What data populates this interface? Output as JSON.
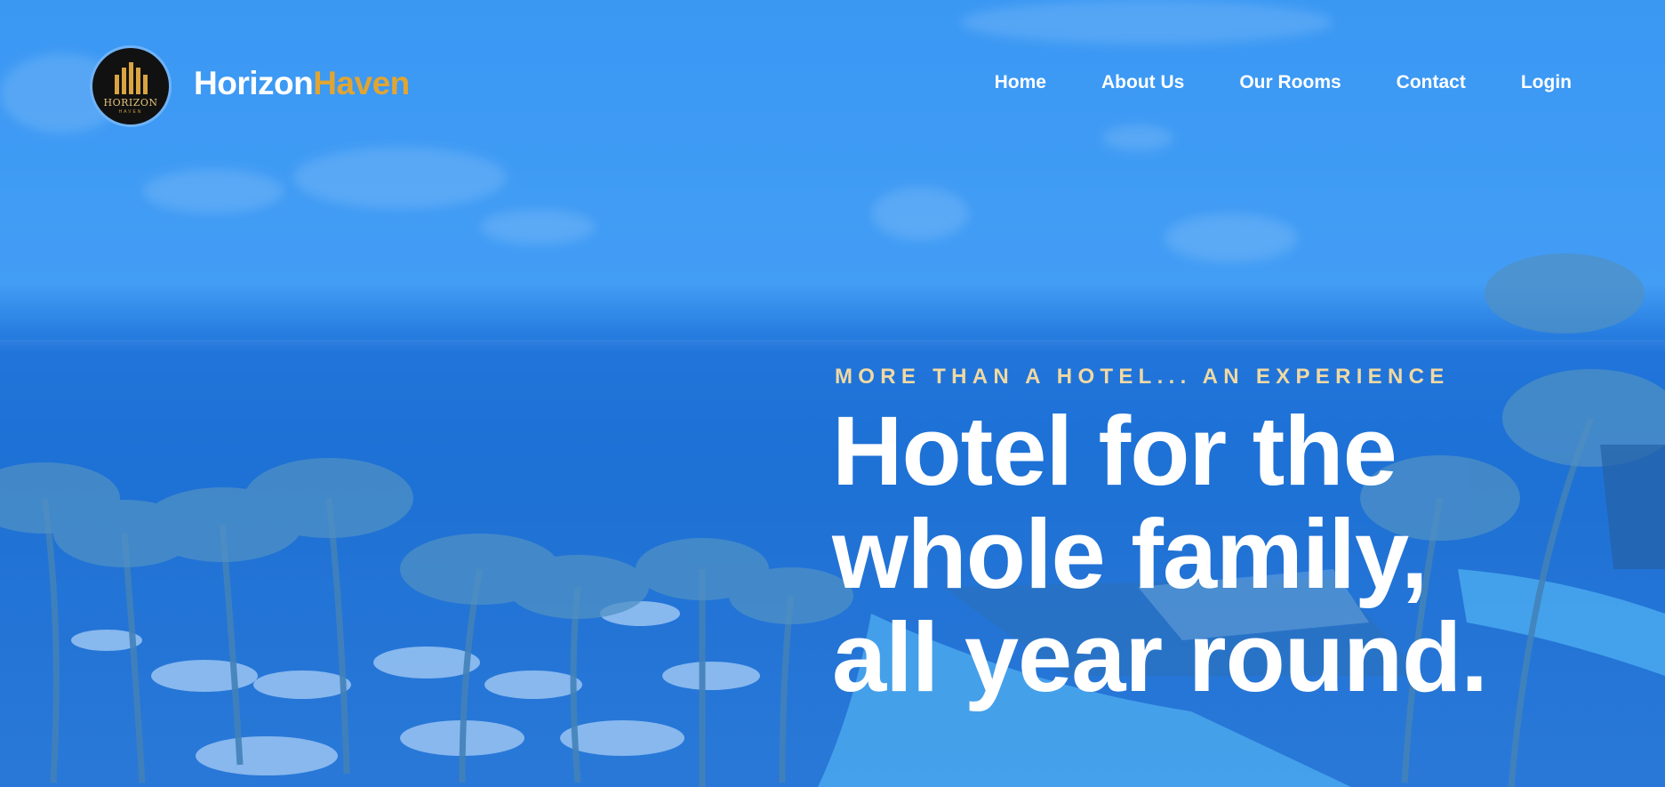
{
  "brand": {
    "part1": "Horizon",
    "part2": "Haven",
    "badge_text": "HORIZON",
    "badge_sub": "HAVEN"
  },
  "nav": {
    "items": [
      {
        "label": "Home"
      },
      {
        "label": "About Us"
      },
      {
        "label": "Our Rooms"
      },
      {
        "label": "Contact"
      },
      {
        "label": "Login"
      }
    ]
  },
  "hero": {
    "eyebrow": "MORE THAN A HOTEL... AN EXPERIENCE",
    "headline_lines": [
      "Hotel for the",
      "whole family,",
      "all year round."
    ]
  },
  "colors": {
    "accent_gold": "#e0a533",
    "eyebrow": "#f0d9a3",
    "overlay_blue": "#3f9bf0"
  }
}
